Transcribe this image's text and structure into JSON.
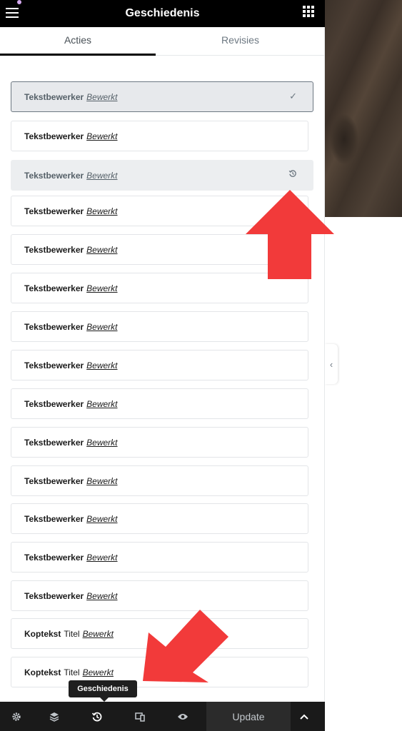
{
  "header": {
    "title": "Geschiedenis"
  },
  "tabs": [
    {
      "label": "Acties"
    },
    {
      "label": "Revisies"
    }
  ],
  "history": {
    "items": [
      {
        "element": "Tekstbewerker",
        "element_suffix": "",
        "action": "Bewerkt",
        "state": "current"
      },
      {
        "element": "Tekstbewerker",
        "element_suffix": "",
        "action": "Bewerkt",
        "state": "normal"
      },
      {
        "element": "Tekstbewerker",
        "element_suffix": "",
        "action": "Bewerkt",
        "state": "restore"
      },
      {
        "element": "Tekstbewerker",
        "element_suffix": "",
        "action": "Bewerkt",
        "state": "normal"
      },
      {
        "element": "Tekstbewerker",
        "element_suffix": "",
        "action": "Bewerkt",
        "state": "normal"
      },
      {
        "element": "Tekstbewerker",
        "element_suffix": "",
        "action": "Bewerkt",
        "state": "normal"
      },
      {
        "element": "Tekstbewerker",
        "element_suffix": "",
        "action": "Bewerkt",
        "state": "normal"
      },
      {
        "element": "Tekstbewerker",
        "element_suffix": "",
        "action": "Bewerkt",
        "state": "normal"
      },
      {
        "element": "Tekstbewerker",
        "element_suffix": "",
        "action": "Bewerkt",
        "state": "normal"
      },
      {
        "element": "Tekstbewerker",
        "element_suffix": "",
        "action": "Bewerkt",
        "state": "normal"
      },
      {
        "element": "Tekstbewerker",
        "element_suffix": "",
        "action": "Bewerkt",
        "state": "normal"
      },
      {
        "element": "Tekstbewerker",
        "element_suffix": "",
        "action": "Bewerkt",
        "state": "normal"
      },
      {
        "element": "Tekstbewerker",
        "element_suffix": "",
        "action": "Bewerkt",
        "state": "normal"
      },
      {
        "element": "Tekstbewerker",
        "element_suffix": "",
        "action": "Bewerkt",
        "state": "normal"
      },
      {
        "element": "Koptekst",
        "element_suffix": "Titel",
        "action": "Bewerkt",
        "state": "normal"
      },
      {
        "element": "Koptekst",
        "element_suffix": "Titel",
        "action": "Bewerkt",
        "state": "normal"
      }
    ]
  },
  "tooltip": {
    "text": "Geschiedenis"
  },
  "footer": {
    "update_label": "Update"
  },
  "icons": {
    "menu": "hamburger-icon",
    "apps": "grid-icon",
    "current": "checkmark-icon",
    "restore": "history-icon",
    "settings": "gear-icon",
    "navigator": "layers-icon",
    "history": "history-icon",
    "responsive": "responsive-icon",
    "preview": "eye-icon",
    "more": "chevron-up-icon",
    "collapse": "chevron-left-icon"
  },
  "colors": {
    "header_bg": "#000000",
    "footer_bg": "#1a1a1a",
    "annotation_arrow": "#f23a3a"
  }
}
